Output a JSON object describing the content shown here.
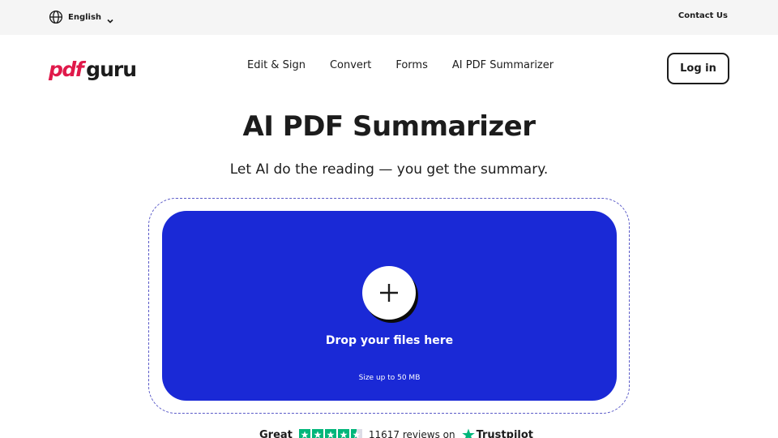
{
  "topbar": {
    "language": "English",
    "contact": "Contact Us"
  },
  "nav": {
    "logo_pdf": "pdf",
    "logo_guru": "guru",
    "links": [
      "Edit & Sign",
      "Convert",
      "Forms",
      "AI PDF Summarizer"
    ],
    "login": "Log in"
  },
  "hero": {
    "title": "AI PDF Summarizer",
    "subtitle": "Let AI do the reading — you get the summary."
  },
  "upload": {
    "drop_text": "Drop your files here",
    "size_text": "Size up to 50 MB"
  },
  "rating": {
    "label": "Great",
    "stars": 4.5,
    "reviews": "11617 reviews on",
    "brand": "Trustpilot"
  },
  "colors": {
    "brand_red": "#e0194a",
    "drop_blue": "#1a29d6",
    "trustpilot_green": "#00b67a"
  }
}
